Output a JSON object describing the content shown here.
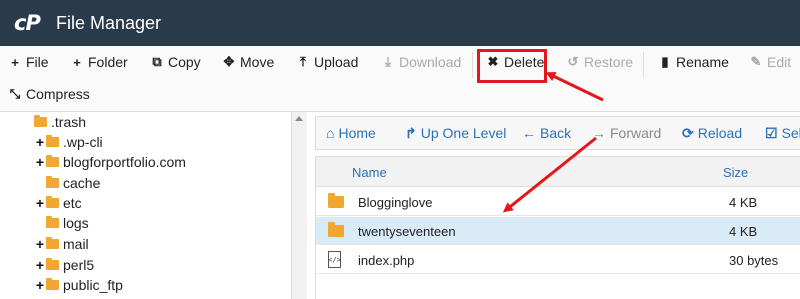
{
  "app": {
    "logo_text": "cP",
    "title": "File Manager"
  },
  "toolbar": {
    "buttons": [
      {
        "label": "File",
        "icon": "plus-icon",
        "glyph": "+",
        "disabled": false
      },
      {
        "label": "Folder",
        "icon": "plus-icon",
        "glyph": "+",
        "disabled": false
      },
      {
        "label": "Copy",
        "icon": "copy-icon",
        "glyph": "⧉",
        "disabled": false
      },
      {
        "label": "Move",
        "icon": "move-icon",
        "glyph": "✥",
        "disabled": false
      },
      {
        "label": "Upload",
        "icon": "upload-icon",
        "glyph": "⤒",
        "disabled": false
      },
      {
        "label": "Download",
        "icon": "download-icon",
        "glyph": "⤓",
        "disabled": true
      },
      {
        "label": "Delete",
        "icon": "close-icon",
        "glyph": "✖",
        "disabled": false
      },
      {
        "label": "Restore",
        "icon": "restore-icon",
        "glyph": "↺",
        "disabled": true
      },
      {
        "label": "Rename",
        "icon": "document-icon",
        "glyph": "▮",
        "disabled": false
      },
      {
        "label": "Edit",
        "icon": "pencil-icon",
        "glyph": "✎",
        "disabled": true
      },
      {
        "label": "Compress",
        "icon": "compress-icon",
        "glyph": "⤡",
        "disabled": false
      }
    ]
  },
  "tree": {
    "items": [
      {
        "label": ".trash",
        "expandable": false
      },
      {
        "label": ".wp-cli",
        "expandable": true
      },
      {
        "label": "blogforportfolio.com",
        "expandable": true
      },
      {
        "label": "cache",
        "expandable": false
      },
      {
        "label": "etc",
        "expandable": true
      },
      {
        "label": "logs",
        "expandable": false
      },
      {
        "label": "mail",
        "expandable": true
      },
      {
        "label": "perl5",
        "expandable": true
      },
      {
        "label": "public_ftp",
        "expandable": true
      }
    ]
  },
  "nav": {
    "buttons": [
      {
        "label": "Home",
        "icon": "home-icon",
        "glyph": "⌂",
        "disabled": false
      },
      {
        "label": "Up One Level",
        "icon": "level-up-icon",
        "glyph": "↱",
        "disabled": false
      },
      {
        "label": "Back",
        "icon": "arrow-left-icon",
        "glyph": "←",
        "disabled": false
      },
      {
        "label": "Forward",
        "icon": "arrow-right-icon",
        "glyph": "→",
        "disabled": true
      },
      {
        "label": "Reload",
        "icon": "refresh-icon",
        "glyph": "⟳",
        "disabled": false
      },
      {
        "label": "Sel",
        "icon": "checkbox-icon",
        "glyph": "☑",
        "disabled": false
      }
    ]
  },
  "files": {
    "columns": {
      "name": "Name",
      "size": "Size"
    },
    "rows": [
      {
        "name": "Blogginglove",
        "size": "4 KB",
        "type": "folder",
        "selected": false
      },
      {
        "name": "twentyseventeen",
        "size": "4 KB",
        "type": "folder",
        "selected": true
      },
      {
        "name": "index.php",
        "size": "30 bytes",
        "type": "file",
        "selected": false
      }
    ]
  },
  "colors": {
    "header_bg": "#293a4a",
    "link_blue": "#2c70b7",
    "annotation_red": "#e3171b",
    "folder": "#f0a830",
    "selected_row": "#d9ebf6"
  }
}
